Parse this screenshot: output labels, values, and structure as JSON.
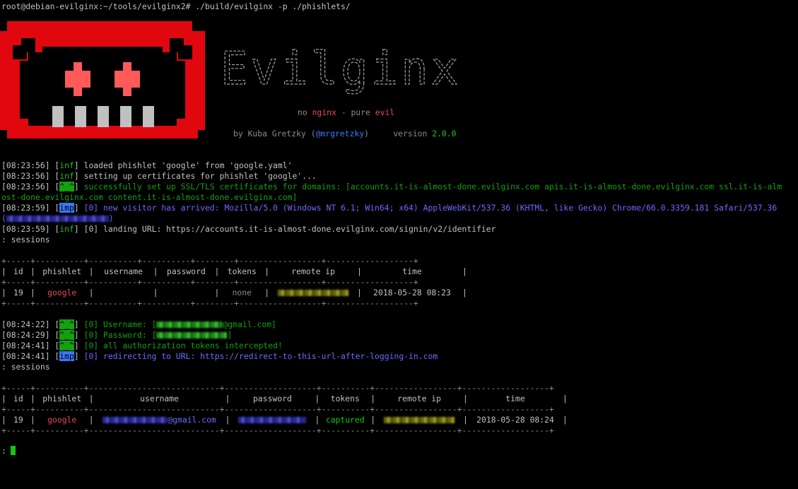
{
  "prompt": "root@debian-evilginx:~/tools/evilginx2# ./build/evilginx -p ./phishlets/",
  "banner": {
    "title": "Evilginx",
    "tagline": [
      "no ",
      "nginx",
      " - ",
      "pure ",
      "evil"
    ],
    "byline": [
      "by Kuba Gretzky (",
      "@mrgretzky",
      ")     version ",
      "2.0.0"
    ],
    "colors": {
      "logo_red": "#e0070f",
      "logo_eye": "#ff5a5a",
      "teeth": "#c0c0c0"
    }
  },
  "log1": [
    {
      "ts": "[08:23:56]",
      "tag": "inf",
      "msg": " loaded phishlet 'google' from 'google.yaml'"
    },
    {
      "ts": "[08:23:56]",
      "tag": "inf",
      "msg": " setting up certificates for phishlet 'google'..."
    },
    {
      "ts": "[08:23:56]",
      "tag": "^_^",
      "msg": " successfully set up SSL/TLS certificates for domains: [accounts.it-is-almost-done.evilginx.com apis.it-is-almost-done.evilginx.com ssl.it-is-alm"
    },
    {
      "cont": "ost-done.evilginx.com content.it-is-almost-done.evilginx.com]"
    },
    {
      "ts": "[08:23:59]",
      "tag": "imp",
      "msg": " [0] new visitor has arrived: Mozilla/5.0 (Windows NT 6.1; Win64; x64) AppleWebKit/537.36 (KHTML, like Gecko) Chrome/66.0.3359.181 Safari/537.36"
    },
    {
      "ts": "[08:23:59]",
      "tag": "inf",
      "msg": " [0] landing URL: https://accounts.it-is-almost-done.evilginx.com/signin/v2/identifier"
    }
  ],
  "sessions_cmd": ": sessions",
  "table1": {
    "border": "+-----+----------+----------+----------+--------+-----------------+------------------+",
    "headers": [
      "id",
      "phishlet",
      "username",
      "password",
      "tokens",
      "remote ip",
      "time"
    ],
    "row": {
      "id": "19",
      "phishlet": "google",
      "username": "",
      "password": "",
      "tokens": "none",
      "time": "2018-05-28 08:23"
    }
  },
  "log2": [
    {
      "ts": "[08:24:22]",
      "tag": "^_^",
      "msg1": " [0] Username: [",
      "msg2": "@gmail.com]"
    },
    {
      "ts": "[08:24:29]",
      "tag": "^_^",
      "msg1": " [0] Password: [",
      "msg2": "]"
    },
    {
      "ts": "[08:24:41]",
      "tag": "^_^",
      "msg1": " [0] all authorization tokens intercepted!",
      "msg2": ""
    },
    {
      "ts": "[08:24:41]",
      "tag": "imp",
      "msg1": " [0] redirecting to URL: https://redirect-to-this-url-after-logging-in.com",
      "msg2": ""
    }
  ],
  "table2": {
    "border": "+-----+----------+---------------------------+-------------------+----------+-----------------+------------------+",
    "headers": [
      "id",
      "phishlet",
      "username",
      "password",
      "tokens",
      "remote ip",
      "time"
    ],
    "row": {
      "id": "19",
      "phishlet": "google",
      "username_suffix": "@gmail.com",
      "tokens": "captured",
      "time": "2018-05-28 08:24"
    }
  },
  "prompt2": ":"
}
